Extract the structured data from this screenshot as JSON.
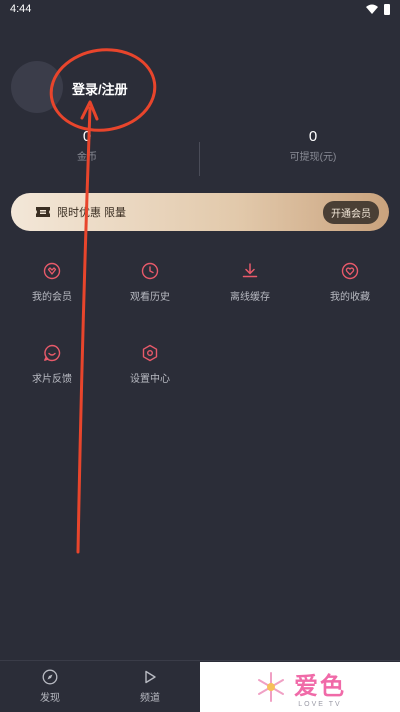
{
  "status_bar": {
    "time": "4:44"
  },
  "profile": {
    "login_label": "登录/注册"
  },
  "stats": {
    "coins": {
      "value": "0",
      "label": "金币"
    },
    "cash": {
      "value": "0",
      "label": "可提现(元)"
    }
  },
  "promo": {
    "text": "限时优惠 限量",
    "button": "开通会员"
  },
  "menu": [
    {
      "label": "我的会员",
      "icon": "vip-heart-icon"
    },
    {
      "label": "观看历史",
      "icon": "clock-icon"
    },
    {
      "label": "离线缓存",
      "icon": "download-icon"
    },
    {
      "label": "我的收藏",
      "icon": "favorite-icon"
    },
    {
      "label": "求片反馈",
      "icon": "feedback-icon"
    },
    {
      "label": "设置中心",
      "icon": "settings-icon"
    }
  ],
  "bottom_nav": [
    {
      "label": "发现",
      "icon": "compass-icon"
    },
    {
      "label": "频道",
      "icon": "play-icon"
    }
  ],
  "watermark": {
    "text": "爱色",
    "subtext": "LOVE TV"
  },
  "colors": {
    "background": "#2b2d38",
    "icon_accent": "#e85a6a",
    "annotation": "#e8452c"
  }
}
